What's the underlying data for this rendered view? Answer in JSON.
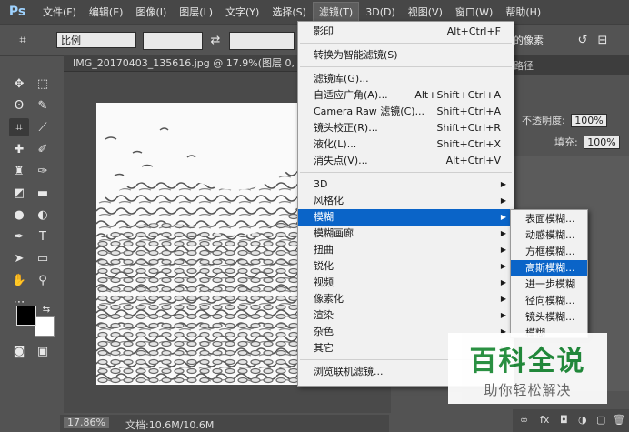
{
  "app": {
    "logo": "Ps"
  },
  "menubar": {
    "items": [
      {
        "label": "文件(F)"
      },
      {
        "label": "编辑(E)"
      },
      {
        "label": "图像(I)"
      },
      {
        "label": "图层(L)"
      },
      {
        "label": "文字(Y)"
      },
      {
        "label": "选择(S)"
      },
      {
        "label": "滤镜(T)",
        "active": true
      },
      {
        "label": "3D(D)"
      },
      {
        "label": "视图(V)"
      },
      {
        "label": "窗口(W)"
      },
      {
        "label": "帮助(H)"
      }
    ]
  },
  "options": {
    "ratio_select": "比例",
    "right_text": "的像素"
  },
  "document": {
    "tab_title": "IMG_20170403_135616.jpg @ 17.9%(图层 0, RGB/8)",
    "status_zoom": "17.86%",
    "status_doc": "文档:10.6M/10.6M"
  },
  "panels": {
    "tab": "路径",
    "opacity_label": "不透明度:",
    "opacity_value": "100%",
    "fill_label": "填充:",
    "fill_value": "100%"
  },
  "filter_menu": {
    "items": [
      {
        "label": "影印",
        "shortcut": "Alt+Ctrl+F"
      },
      {
        "label": "转换为智能滤镜(S)",
        "shortcut": ""
      },
      {
        "label": "滤镜库(G)...",
        "shortcut": ""
      },
      {
        "label": "自适应广角(A)...",
        "shortcut": "Alt+Shift+Ctrl+A"
      },
      {
        "label": "Camera Raw 滤镜(C)...",
        "shortcut": "Shift+Ctrl+A"
      },
      {
        "label": "镜头校正(R)...",
        "shortcut": "Shift+Ctrl+R"
      },
      {
        "label": "液化(L)...",
        "shortcut": "Shift+Ctrl+X"
      },
      {
        "label": "消失点(V)...",
        "shortcut": "Alt+Ctrl+V"
      },
      {
        "label": "3D",
        "shortcut": ""
      },
      {
        "label": "风格化",
        "shortcut": ""
      },
      {
        "label": "模糊",
        "shortcut": ""
      },
      {
        "label": "模糊画廊",
        "shortcut": ""
      },
      {
        "label": "扭曲",
        "shortcut": ""
      },
      {
        "label": "锐化",
        "shortcut": ""
      },
      {
        "label": "视频",
        "shortcut": ""
      },
      {
        "label": "像素化",
        "shortcut": ""
      },
      {
        "label": "渲染",
        "shortcut": ""
      },
      {
        "label": "杂色",
        "shortcut": ""
      },
      {
        "label": "其它",
        "shortcut": ""
      },
      {
        "label": "浏览联机滤镜...",
        "shortcut": ""
      }
    ]
  },
  "blur_submenu": {
    "items": [
      {
        "label": "表面模糊..."
      },
      {
        "label": "动感模糊..."
      },
      {
        "label": "方框模糊..."
      },
      {
        "label": "高斯模糊..."
      },
      {
        "label": "进一步模糊"
      },
      {
        "label": "径向模糊..."
      },
      {
        "label": "镜头模糊..."
      },
      {
        "label": "模糊"
      }
    ]
  },
  "watermark": {
    "main": "百科全说",
    "sub": "助你轻松解决"
  }
}
